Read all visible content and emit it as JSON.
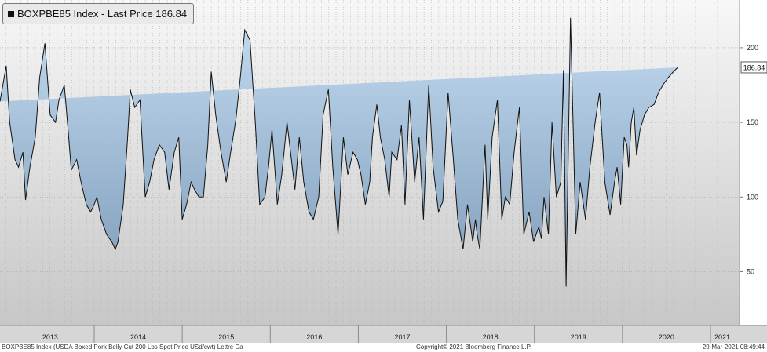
{
  "legend": {
    "text": "BOXPBE85 Index - Last Price 186.84"
  },
  "footer": {
    "left": "BOXPBE85 Index (USDA Boxed Pork Belly Cut 200 Lbs Spot Price USd/cwt) Lettre  Da",
    "center": "Copyright© 2021 Bloomberg Finance L.P.",
    "right": "29-Mar-2021 08:49:44"
  },
  "colors": {
    "fill_top": "#bcd6ef",
    "fill_bottom": "#7f9cb8",
    "line": "#111111",
    "last_marker": "#f5a623",
    "bg_top": "#f7f7f7",
    "bg_bottom": "#bdbdbd"
  },
  "chart_data": {
    "type": "area",
    "title": "BOXPBE85 Index - Last Price 186.84",
    "xlabel": "",
    "ylabel": "",
    "ylim": [
      14,
      232
    ],
    "xlim": [
      2012.85,
      2021.25
    ],
    "grid": true,
    "y_ticks": [
      50,
      100,
      150,
      200
    ],
    "x_tick_labels": [
      "2013",
      "2014",
      "2015",
      "2016",
      "2017",
      "2018",
      "2019",
      "2020",
      "2021"
    ],
    "last_price": 186.84,
    "x": [
      2012.85,
      2012.92,
      2012.96,
      2013.02,
      2013.06,
      2013.11,
      2013.14,
      2013.19,
      2013.25,
      2013.3,
      2013.36,
      2013.42,
      2013.48,
      2013.52,
      2013.58,
      2013.63,
      2013.66,
      2013.72,
      2013.77,
      2013.83,
      2013.88,
      2013.92,
      2013.95,
      2014.0,
      2014.06,
      2014.12,
      2014.16,
      2014.19,
      2014.25,
      2014.3,
      2014.33,
      2014.38,
      2014.44,
      2014.5,
      2014.55,
      2014.6,
      2014.66,
      2014.72,
      2014.77,
      2014.83,
      2014.88,
      2014.92,
      2014.97,
      2015.02,
      2015.06,
      2015.11,
      2015.16,
      2015.21,
      2015.25,
      2015.3,
      2015.36,
      2015.42,
      2015.47,
      2015.53,
      2015.58,
      2015.63,
      2015.69,
      2015.75,
      2015.8,
      2015.86,
      2015.9,
      2015.94,
      2016.0,
      2016.05,
      2016.11,
      2016.16,
      2016.2,
      2016.25,
      2016.3,
      2016.36,
      2016.41,
      2016.47,
      2016.52,
      2016.58,
      2016.63,
      2016.69,
      2016.75,
      2016.8,
      2016.86,
      2016.91,
      2016.95,
      2017.0,
      2017.05,
      2017.08,
      2017.13,
      2017.17,
      2017.22,
      2017.27,
      2017.3,
      2017.36,
      2017.41,
      2017.45,
      2017.5,
      2017.56,
      2017.61,
      2017.66,
      2017.72,
      2017.77,
      2017.83,
      2017.88,
      2017.94,
      2018.0,
      2018.05,
      2018.11,
      2018.16,
      2018.22,
      2018.25,
      2018.27,
      2018.3,
      2018.36,
      2018.39,
      2018.44,
      2018.5,
      2018.55,
      2018.59,
      2018.64,
      2018.69,
      2018.75,
      2018.8,
      2018.86,
      2018.91,
      2018.97,
      2019.0,
      2019.03,
      2019.08,
      2019.12,
      2019.17,
      2019.22,
      2019.25,
      2019.28,
      2019.33,
      2019.39,
      2019.44,
      2019.5,
      2019.55,
      2019.61,
      2019.66,
      2019.72,
      2019.78,
      2019.83,
      2019.86,
      2019.9,
      2019.94,
      2019.97,
      2019.99,
      2020.02,
      2020.05,
      2020.08,
      2020.12,
      2020.17,
      2020.22,
      2020.28,
      2020.33,
      2020.39,
      2020.44,
      2020.5,
      2020.55,
      2020.61,
      2020.65,
      2020.7,
      2020.75,
      2020.8,
      2020.86,
      2020.91,
      2020.95,
      2021.0,
      2021.05,
      2021.1,
      2021.15,
      2021.2,
      2021.24
    ],
    "values": [
      164,
      188,
      150,
      125,
      120,
      130,
      98,
      120,
      140,
      180,
      203,
      155,
      150,
      165,
      175,
      140,
      118,
      125,
      110,
      95,
      90,
      95,
      100,
      85,
      75,
      70,
      65,
      70,
      95,
      140,
      172,
      160,
      165,
      100,
      110,
      125,
      135,
      130,
      105,
      130,
      140,
      85,
      95,
      110,
      105,
      100,
      100,
      135,
      184,
      155,
      130,
      110,
      130,
      152,
      180,
      212,
      205,
      150,
      95,
      100,
      120,
      145,
      95,
      115,
      150,
      125,
      105,
      140,
      110,
      90,
      85,
      100,
      155,
      172,
      120,
      75,
      140,
      115,
      130,
      125,
      115,
      95,
      110,
      140,
      162,
      140,
      125,
      100,
      130,
      125,
      148,
      95,
      165,
      110,
      140,
      85,
      175,
      120,
      90,
      97,
      170,
      125,
      85,
      65,
      95,
      70,
      85,
      75,
      65,
      135,
      85,
      140,
      165,
      85,
      100,
      95,
      130,
      160,
      75,
      90,
      70,
      80,
      72,
      100,
      75,
      150,
      100,
      110,
      185,
      40,
      220,
      75,
      110,
      85,
      120,
      150,
      170,
      110,
      88,
      110,
      120,
      95,
      140,
      135,
      120,
      150,
      160,
      128,
      145,
      155,
      160,
      162,
      170,
      176,
      180,
      184,
      186.84
    ]
  }
}
